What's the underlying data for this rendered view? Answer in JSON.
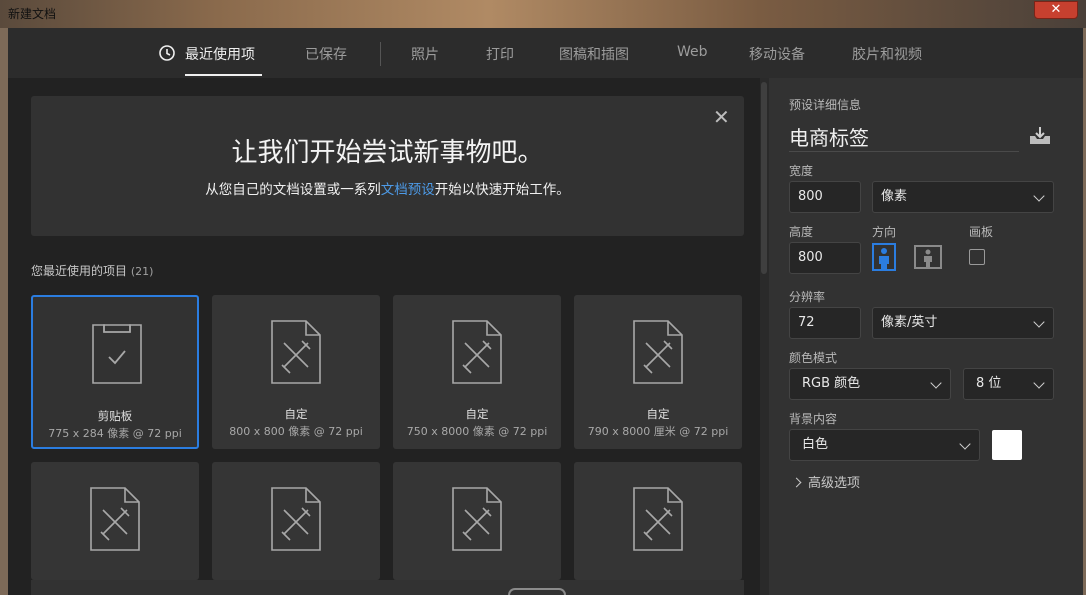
{
  "window": {
    "title": "新建文档",
    "close_label": "✕"
  },
  "nav": {
    "tabs": [
      {
        "label": "最近使用项",
        "active": true
      },
      {
        "label": "已保存"
      },
      {
        "label": "照片"
      },
      {
        "label": "打印"
      },
      {
        "label": "图稿和插图"
      },
      {
        "label": "Web"
      },
      {
        "label": "移动设备"
      },
      {
        "label": "胶片和视频"
      }
    ]
  },
  "banner": {
    "title": "让我们开始尝试新事物吧。",
    "sub_before": "从您自己的文档设置或一系列",
    "sub_link": "文档预设",
    "sub_after": "开始以快速开始工作。"
  },
  "recent": {
    "label": "您最近使用的项目",
    "count": "(21)",
    "items": [
      {
        "name": "剪贴板",
        "meta": "775 x 284 像素 @ 72 ppi",
        "icon": "clipboard-icon",
        "selected": true
      },
      {
        "name": "自定",
        "meta": "800 x 800 像素 @ 72 ppi",
        "icon": "document-pencil-icon"
      },
      {
        "name": "自定",
        "meta": "750 x 8000 像素 @ 72 ppi",
        "icon": "document-pencil-icon"
      },
      {
        "name": "自定",
        "meta": "790 x 8000 厘米 @ 72 ppi",
        "icon": "document-pencil-icon"
      },
      {
        "name": "",
        "meta": "",
        "icon": "document-pencil-icon"
      },
      {
        "name": "",
        "meta": "",
        "icon": "document-pencil-icon"
      },
      {
        "name": "",
        "meta": "",
        "icon": "document-pencil-icon"
      },
      {
        "name": "",
        "meta": "",
        "icon": "document-pencil-icon"
      }
    ]
  },
  "details": {
    "section_label": "预设详细信息",
    "preset_name": "电商标签",
    "width_label": "宽度",
    "width_value": "800",
    "width_unit": "像素",
    "height_label": "高度",
    "height_value": "800",
    "orientation_label": "方向",
    "artboard_label": "画板",
    "resolution_label": "分辨率",
    "resolution_value": "72",
    "resolution_unit": "像素/英寸",
    "color_mode_label": "颜色模式",
    "color_mode": "RGB 颜色",
    "bit_depth": "8 位",
    "background_label": "背景内容",
    "background": "白色",
    "background_color": "#ffffff",
    "advanced_label": "高级选项"
  },
  "colors": {
    "accent": "#2b7de0",
    "link": "#4d9be8"
  }
}
